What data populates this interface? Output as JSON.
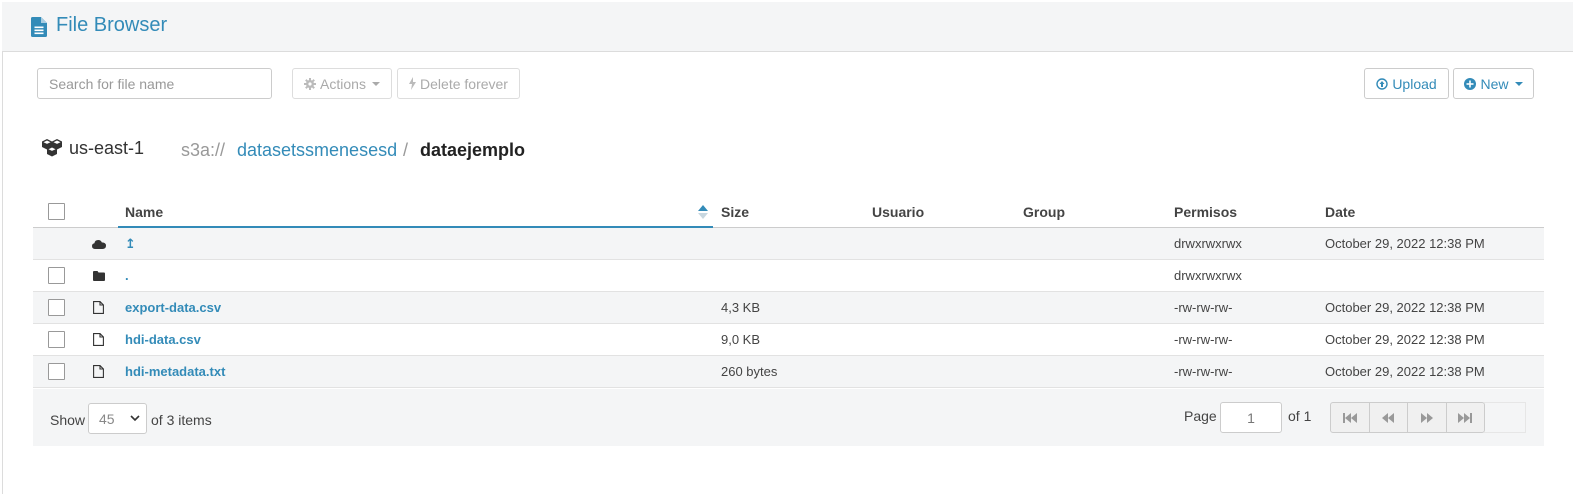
{
  "app": {
    "title": "File Browser",
    "icon": "file-icon"
  },
  "toolbar": {
    "search_placeholder": "Search for file name",
    "actions_label": "Actions",
    "delete_label": "Delete forever",
    "upload_label": "Upload",
    "new_label": "New"
  },
  "breadcrumb": {
    "region": "us-east-1",
    "scheme": "s3a://",
    "bucket": "datasetssmenesesd",
    "separator": "/",
    "current": "dataejemplo"
  },
  "table": {
    "columns": {
      "name": "Name",
      "size": "Size",
      "user": "Usuario",
      "group": "Group",
      "permissions": "Permisos",
      "date": "Date"
    },
    "rows": [
      {
        "icon": "cloud-icon",
        "name": "↥",
        "size": "",
        "user": "",
        "group": "",
        "permissions": "drwxrwxrwx",
        "date": "October 29, 2022 12:38 PM",
        "checkbox": false
      },
      {
        "icon": "folder-icon",
        "name": ".",
        "size": "",
        "user": "",
        "group": "",
        "permissions": "drwxrwxrwx",
        "date": "",
        "checkbox": true
      },
      {
        "icon": "file-icon",
        "name": "export-data.csv",
        "size": "4,3 KB",
        "user": "",
        "group": "",
        "permissions": "-rw-rw-rw-",
        "date": "October 29, 2022 12:38 PM",
        "checkbox": true
      },
      {
        "icon": "file-icon",
        "name": "hdi-data.csv",
        "size": "9,0 KB",
        "user": "",
        "group": "",
        "permissions": "-rw-rw-rw-",
        "date": "October 29, 2022 12:38 PM",
        "checkbox": true
      },
      {
        "icon": "file-icon",
        "name": "hdi-metadata.txt",
        "size": "260 bytes",
        "user": "",
        "group": "",
        "permissions": "-rw-rw-rw-",
        "date": "October 29, 2022 12:38 PM",
        "checkbox": true
      }
    ]
  },
  "footer": {
    "show_label": "Show",
    "page_size": "45",
    "items_label": "of 3 items",
    "page_label": "Page",
    "page_value": "1",
    "of_pages": "of 1"
  },
  "colors": {
    "accent": "#338bb8",
    "header_bg": "#f4f5f6"
  }
}
